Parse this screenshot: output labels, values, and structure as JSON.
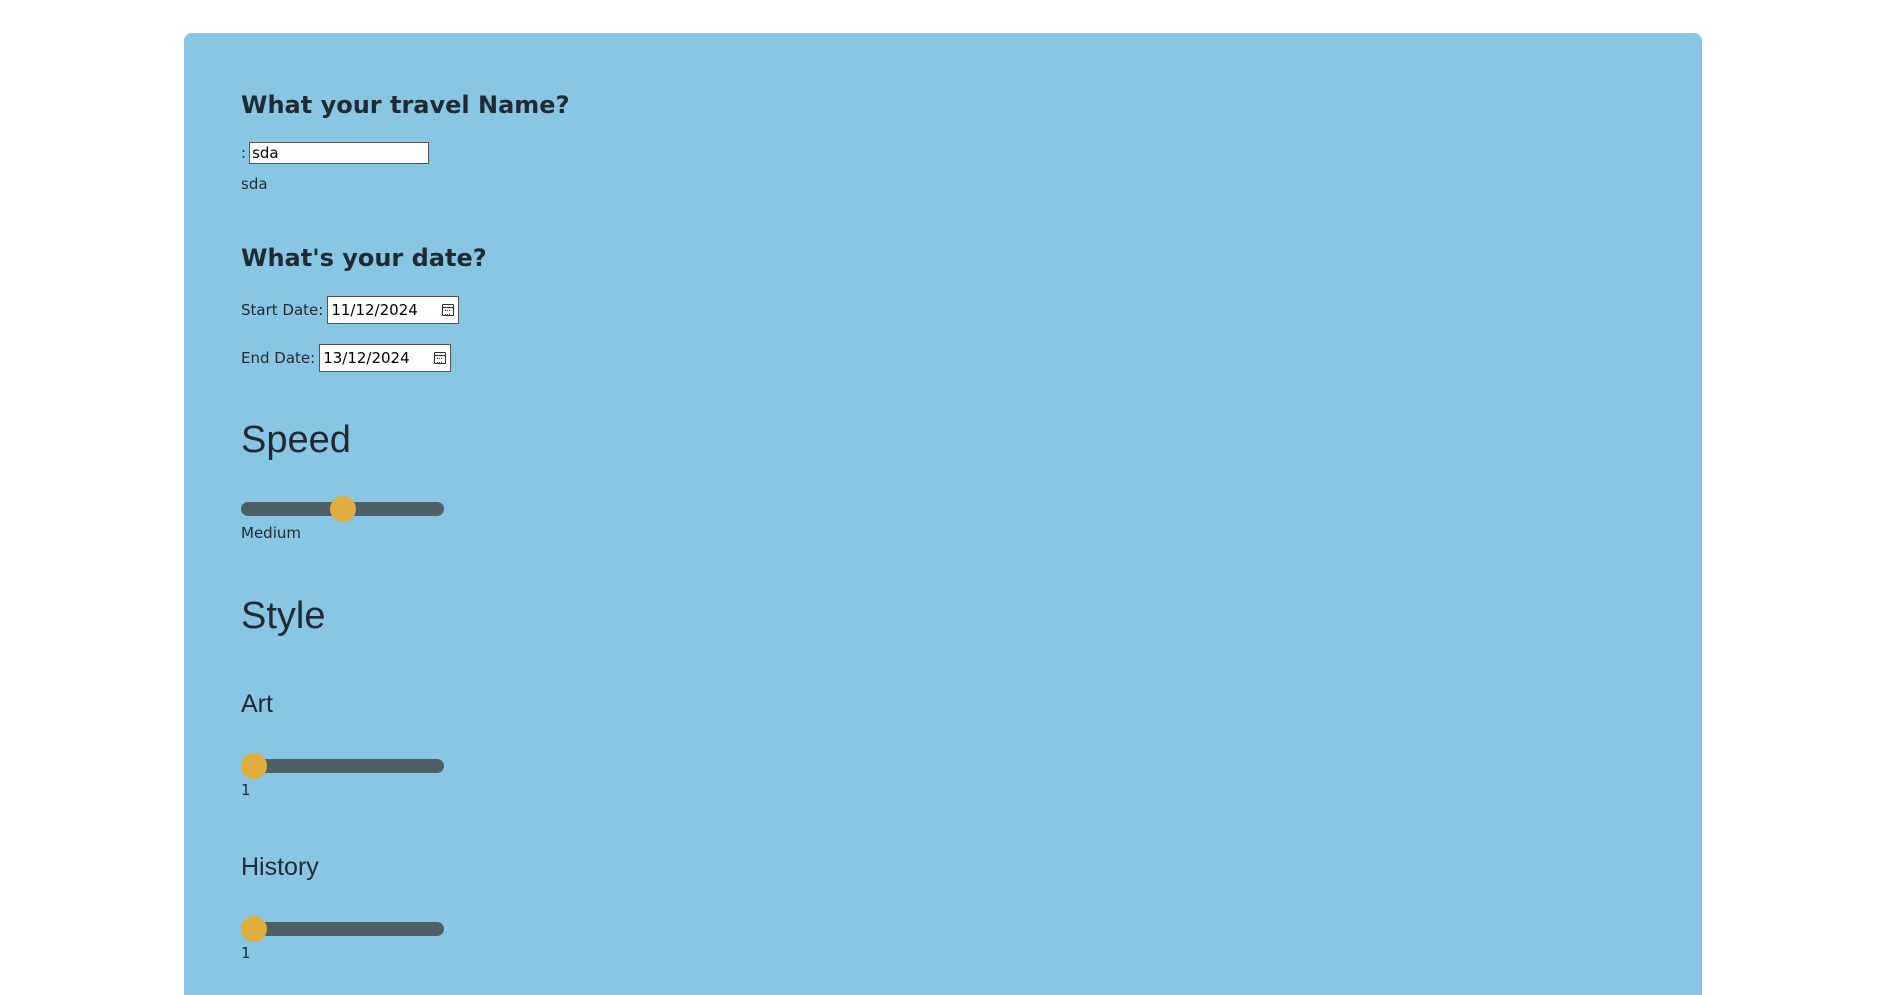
{
  "travel_name": {
    "heading": "What your travel Name?",
    "prefix": ":",
    "input_value": "sda",
    "echo": "sda"
  },
  "dates": {
    "heading": "What's your date?",
    "start_label": "Start Date:",
    "start_value": "11/12/2024",
    "end_label": "End Date:",
    "end_value": "13/12/2024"
  },
  "speed": {
    "heading": "Speed",
    "level": 0.5,
    "value_label": "Medium"
  },
  "style": {
    "heading": "Style",
    "art": {
      "label": "Art",
      "level": 0,
      "value": "1"
    },
    "history": {
      "label": "History",
      "level": 0,
      "value": "1"
    }
  },
  "colors": {
    "panel_background": "#89c6e4",
    "slider_track": "#4e5f66",
    "slider_thumb": "#e0ad3f"
  }
}
